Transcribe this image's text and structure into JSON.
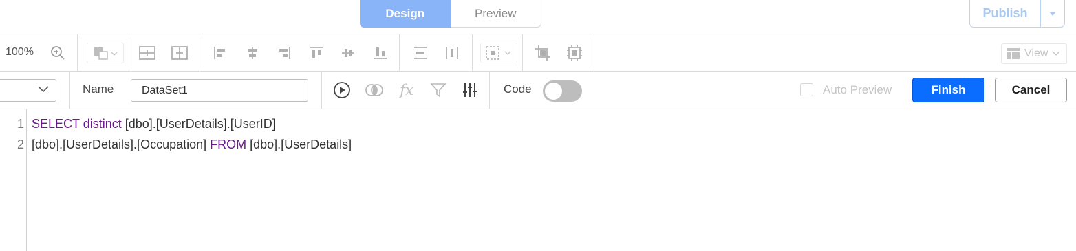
{
  "mode_tabs": {
    "design": "Design",
    "preview": "Preview"
  },
  "publish": {
    "label": "Publish"
  },
  "toolbar": {
    "zoom": "100%",
    "view_label": "View"
  },
  "query": {
    "name_label": "Name",
    "name_value": "DataSet1",
    "code_label": "Code",
    "code_toggle_on": false,
    "auto_preview_label": "Auto Preview",
    "auto_preview_checked": false,
    "finish_label": "Finish",
    "cancel_label": "Cancel"
  },
  "editor": {
    "line_numbers": [
      "1",
      "2"
    ],
    "line1": {
      "kw1": "SELECT distinct",
      "rest": " [dbo].[UserDetails].[UserID]"
    },
    "line2": {
      "part1": "[dbo].[UserDetails].[Occupation] ",
      "kw": "FROM",
      "part2": " [dbo].[UserDetails]"
    }
  },
  "colors": {
    "accent": "#0a6dff",
    "keyword": "#6a1a8a",
    "design_tab": "#8ab4f8"
  }
}
